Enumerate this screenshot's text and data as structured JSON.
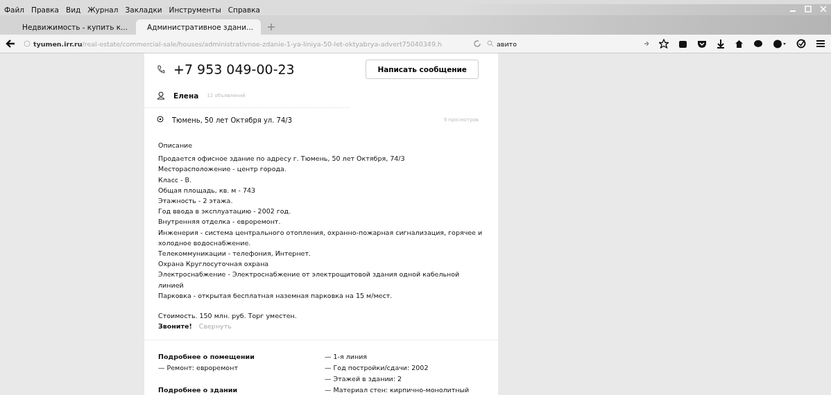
{
  "menu": [
    "Файл",
    "Правка",
    "Вид",
    "Журнал",
    "Закладки",
    "Инструменты",
    "Справка"
  ],
  "tabs": [
    {
      "title": "Недвижимость - купить к...",
      "selected": false
    },
    {
      "title": "Административное здани...",
      "selected": true
    }
  ],
  "address_bar": {
    "host": "tyumen.irr.ru",
    "path": "/real-estate/commercial-sale/houses/administrativnoe-zdanie-1-ya-liniya-50-let-oktyabrya-advert75040349.h"
  },
  "search": {
    "value": "авито"
  },
  "listing": {
    "phone": "+7 953 049-00-23",
    "message_button": "Написать сообщение",
    "seller": {
      "name": "Елена",
      "ads": "12 объявлений"
    },
    "address": "Тюмень, 50 лет Октября ул. 74/3",
    "views": "9 просмотров",
    "description": {
      "title": "Описание",
      "paragraphs": [
        "Продается офисное здание по адресу г. Тюмень, 50 лет Октября, 74/3",
        "Месторасположение - центр города.",
        "Класс - В.",
        "Общая площадь, кв. м - 743",
        "Этажность - 2 этажа.",
        "Год ввода в эксплуатацию - 2002 год.",
        "Внутренняя отделка - евроремонт.",
        "Инженерия - система центрального отопления, охранно-пожарная сигнализация, горячее и холодное водоснабжение.",
        "Телекоммуникации - телефония, Интернет.",
        "Охрана Круглосуточная охрана",
        "Электроснабжение - Электроснабжение от электрощитовой здания одной кабельной линией",
        "Парковка - открытая бесплатная наземная парковка на 15 м/мест."
      ]
    },
    "price_note": "Стоимость. 150 млн. руб. Торг уместен.",
    "call": "Звоните!",
    "collapse": "Свернуть"
  },
  "details": {
    "left": [
      {
        "kind": "heading",
        "text": "Подробнее о помещении"
      },
      {
        "kind": "item",
        "text": "—  Ремонт: евроремонт"
      },
      {
        "kind": "heading",
        "text": "Подробнее о здании"
      }
    ],
    "right": [
      {
        "kind": "item",
        "text": "—  1-я линия"
      },
      {
        "kind": "item",
        "text": "—  Год постройки/сдачи: 2002"
      },
      {
        "kind": "item",
        "text": "—  Этажей в здании: 2"
      },
      {
        "kind": "item",
        "text": "—  Материал стен: кирпично-монолитный"
      }
    ]
  }
}
